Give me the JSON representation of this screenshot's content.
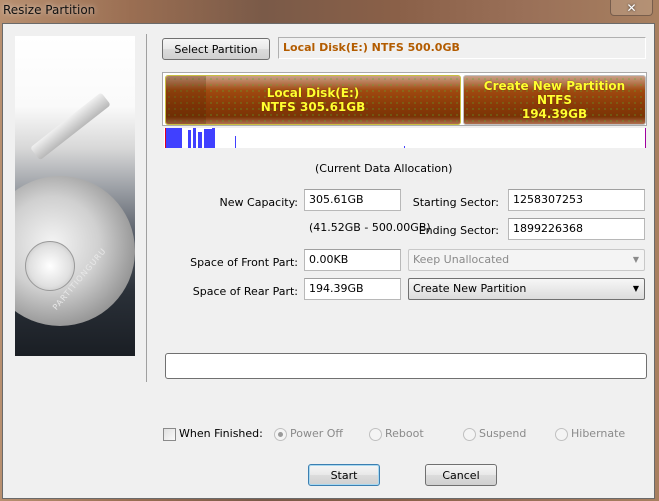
{
  "window": {
    "title": "Resize Partition",
    "close_icon": "close-icon"
  },
  "sidebar": {
    "brand_text": "PARTITIONGURU"
  },
  "toolbar": {
    "select_partition_label": "Select Partition",
    "partition_info": "Local Disk(E:) NTFS 500.0GB"
  },
  "disk_map": {
    "partitions": [
      {
        "name": "Local Disk(E:)",
        "detail": "NTFS 305.61GB",
        "size_gb": 305.61
      },
      {
        "name": "Create New Partition",
        "detail": "NTFS",
        "size": "194.39GB",
        "size_gb": 194.39
      }
    ],
    "total_gb": 500.0,
    "colors": {
      "partition_text": "#ffff30",
      "used_data": "#4040ff",
      "partition_fill": "#8a3a08"
    }
  },
  "allocation": {
    "caption": "(Current Data Allocation)"
  },
  "form": {
    "new_capacity_label": "New Capacity:",
    "new_capacity_value": "305.61GB",
    "capacity_range": "(41.52GB - 500.00GB)",
    "starting_sector_label": "Starting Sector:",
    "starting_sector_value": "1258307253",
    "ending_sector_label": "Ending Sector:",
    "ending_sector_value": "1899226368",
    "front_space_label": "Space of Front Part:",
    "front_space_value": "0.00KB",
    "front_action": "Keep Unallocated",
    "rear_space_label": "Space of Rear Part:",
    "rear_space_value": "194.39GB",
    "rear_action": "Create New Partition"
  },
  "progress": {
    "value_percent": 0
  },
  "finish": {
    "checkbox_label": "When Finished:",
    "checked": false,
    "options": [
      {
        "label": "Power Off",
        "selected": true
      },
      {
        "label": "Reboot",
        "selected": false
      },
      {
        "label": "Suspend",
        "selected": false
      },
      {
        "label": "Hibernate",
        "selected": false
      }
    ]
  },
  "actions": {
    "start_label": "Start",
    "cancel_label": "Cancel"
  }
}
